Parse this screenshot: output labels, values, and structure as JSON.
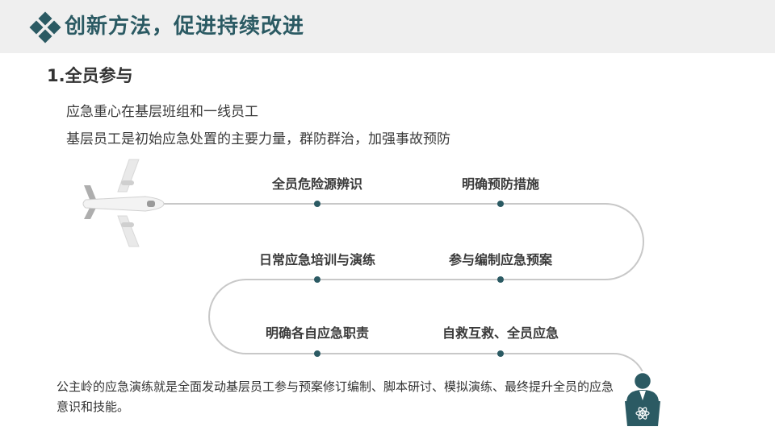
{
  "header": {
    "title": "创新方法，促进持续改进",
    "accent_color": "#2b5a63",
    "background_color": "#efefef",
    "icon": "diamond-cluster-icon"
  },
  "section": {
    "title": "1.全员参与"
  },
  "intro": {
    "line1": "应急重心在基层班组和一线员工",
    "line2": "基层员工是初始应急处置的主要力量，群防群治，加强事故预防"
  },
  "roadmap": {
    "start_icon": "airplane-icon",
    "end_icon": "presenter-icon",
    "row1": [
      "全员危险源辨识",
      "明确预防措施"
    ],
    "row2": [
      "日常应急培训与演练",
      "参与编制应急预案"
    ],
    "row3": [
      "明确各自应急职责",
      "自救互救、全员应急"
    ],
    "dot_color": "#2b5a63",
    "line_color": "#c8c8c8"
  },
  "summary": {
    "text": "公主岭的应急演练就是全面发动基层员工参与预案修订编制、脚本研讨、模拟演练、最终提升全员的应急意识和技能。"
  }
}
